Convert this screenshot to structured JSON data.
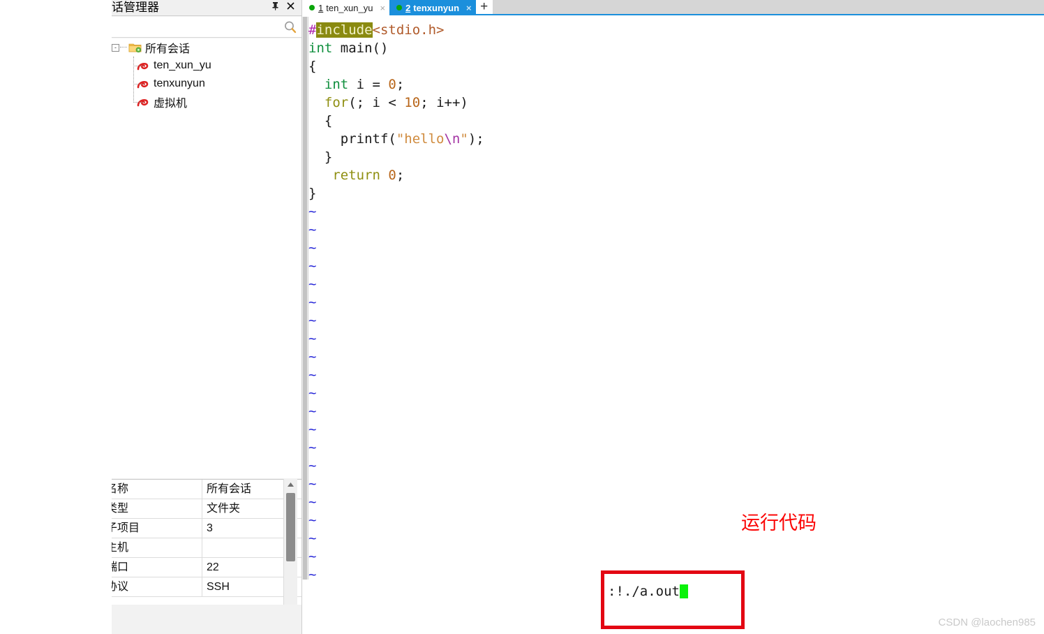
{
  "session_panel": {
    "title": "话管理器",
    "pin_icon": "pin-icon",
    "close_icon": "close-icon",
    "search": {
      "value": "",
      "placeholder": "",
      "icon": "search-icon"
    },
    "tree": {
      "root": {
        "label": "所有会话",
        "expander": "-",
        "icon": "folder-settings-icon"
      },
      "children": [
        {
          "label": "ten_xun_yu",
          "icon": "session-icon"
        },
        {
          "label": "tenxunyun",
          "icon": "session-icon"
        },
        {
          "label": "虚拟机",
          "icon": "session-icon"
        }
      ]
    },
    "properties": {
      "rows": [
        {
          "key": "名称",
          "value": "所有会话"
        },
        {
          "key": "类型",
          "value": "文件夹"
        },
        {
          "key": "子项目",
          "value": "3"
        },
        {
          "key": "主机",
          "value": ""
        },
        {
          "key": "端口",
          "value": "22"
        },
        {
          "key": "协议",
          "value": "SSH"
        }
      ],
      "scroll_up_icon": "scroll-up-arrow-icon"
    }
  },
  "terminal": {
    "tabs": [
      {
        "number": "1",
        "label": "ten_xun_yu",
        "active": false,
        "status": "connected",
        "close": "×"
      },
      {
        "number": "2",
        "label": "tenxunyun",
        "active": true,
        "status": "connected",
        "close": "×"
      }
    ],
    "new_tab_label": "+",
    "accent_color": "#1b8fdc",
    "status_dot_color": "#0aa50a"
  },
  "editor": {
    "code_lines": [
      {
        "segments": [
          {
            "t": "#",
            "c": "pp-hash"
          },
          {
            "t": "include",
            "c": "pp-word"
          },
          {
            "t": "<stdio.h>",
            "c": "inc-file"
          }
        ]
      },
      {
        "segments": [
          {
            "t": "int",
            "c": "kw-int"
          },
          {
            "t": " main()",
            "c": ""
          }
        ]
      },
      {
        "segments": [
          {
            "t": "{",
            "c": ""
          }
        ]
      },
      {
        "segments": [
          {
            "t": "  ",
            "c": ""
          },
          {
            "t": "int",
            "c": "kw-int"
          },
          {
            "t": " i = ",
            "c": ""
          },
          {
            "t": "0",
            "c": "num"
          },
          {
            "t": ";",
            "c": ""
          }
        ]
      },
      {
        "segments": [
          {
            "t": "  ",
            "c": ""
          },
          {
            "t": "for",
            "c": "kw-stmt"
          },
          {
            "t": "(; i < ",
            "c": ""
          },
          {
            "t": "10",
            "c": "num"
          },
          {
            "t": "; i++)",
            "c": ""
          }
        ]
      },
      {
        "segments": [
          {
            "t": "  {",
            "c": ""
          }
        ]
      },
      {
        "segments": [
          {
            "t": "    printf(",
            "c": ""
          },
          {
            "t": "\"hello",
            "c": "str"
          },
          {
            "t": "\\n",
            "c": "esc"
          },
          {
            "t": "\"",
            "c": "str"
          },
          {
            "t": ");",
            "c": ""
          }
        ]
      },
      {
        "segments": [
          {
            "t": "  }",
            "c": ""
          }
        ]
      },
      {
        "segments": [
          {
            "t": "   ",
            "c": ""
          },
          {
            "t": "return",
            "c": "kw-stmt"
          },
          {
            "t": " ",
            "c": ""
          },
          {
            "t": "0",
            "c": "num"
          },
          {
            "t": ";",
            "c": ""
          }
        ]
      },
      {
        "segments": [
          {
            "t": "}",
            "c": ""
          }
        ]
      }
    ],
    "empty_line_marker": "~",
    "empty_line_count": 21,
    "command_line": ":!./a.out",
    "cursor": "block"
  },
  "annotation": {
    "text": "运行代码",
    "text_color": "#fb0505",
    "box_color": "#e30613"
  },
  "watermark": "CSDN @laochen985"
}
